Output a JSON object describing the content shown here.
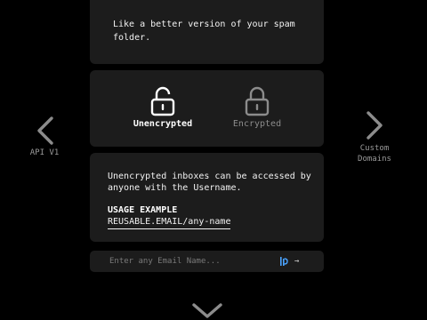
{
  "top_card": {
    "text": "Like a better version of your spam folder."
  },
  "locks": {
    "unencrypted_label": "Unencrypted",
    "encrypted_label": "Encrypted",
    "selected": "unencrypted"
  },
  "info": {
    "text": "Unencrypted inboxes can be accessed by anyone with the Username.",
    "usage_title": "USAGE EXAMPLE",
    "usage_example": "REUSABLE.EMAIL/any-name"
  },
  "email_input": {
    "placeholder": "Enter any Email Name...",
    "value": "",
    "submit_glyph": "→"
  },
  "nav": {
    "left_label": "API V1",
    "right_label": "Custom Domains"
  },
  "colors": {
    "background": "#000000",
    "card": "#1c1c1c",
    "active": "#ffffff",
    "inactive": "#8c8c8c",
    "toggle_accent": "#4aa3ff"
  }
}
